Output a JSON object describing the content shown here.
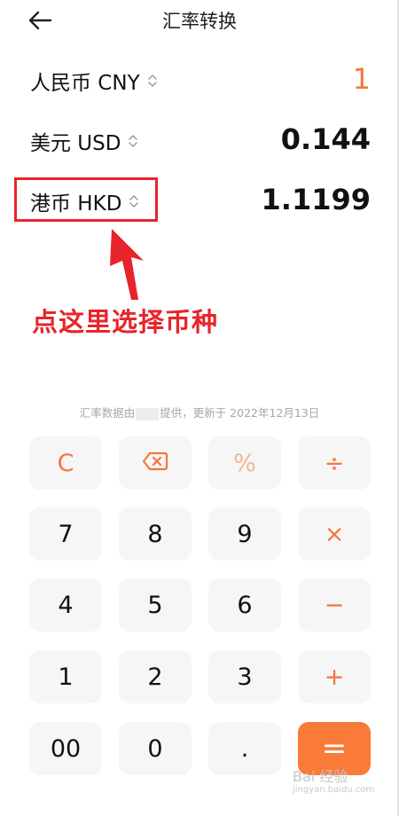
{
  "header": {
    "title": "汇率转换",
    "back_icon": "arrow-left-icon"
  },
  "currencies": [
    {
      "name": "人民币 CNY",
      "value": "1",
      "active": true
    },
    {
      "name": "美元 USD",
      "value": "0.144",
      "active": false
    },
    {
      "name": "港币 HKD",
      "value": "1.1199",
      "active": false
    }
  ],
  "annotation": {
    "text": "点这里选择币种",
    "color": "#e8242b"
  },
  "source_note": {
    "prefix": "汇率数据由",
    "suffix": "提供，更新于 2022年12月13日"
  },
  "keypad": {
    "rows": [
      [
        "C",
        "⌫",
        "%",
        "÷"
      ],
      [
        "7",
        "8",
        "9",
        "×"
      ],
      [
        "4",
        "5",
        "6",
        "−"
      ],
      [
        "1",
        "2",
        "3",
        "+"
      ],
      [
        "00",
        "0",
        ".",
        "="
      ]
    ]
  },
  "watermark": {
    "text": "Bai 经验",
    "sub": "jingyan.baidu.com"
  },
  "colors": {
    "accent": "#f5763a",
    "equals_bg": "#fa7a3a",
    "highlight": "#e8242b"
  }
}
